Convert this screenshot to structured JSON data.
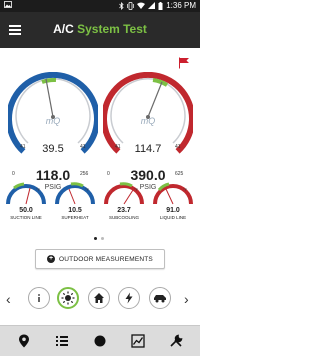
{
  "status_bar": {
    "time": "1:36 PM",
    "left_icon": "image-icon",
    "right_icons": [
      "bluetooth-icon",
      "vibrate-icon",
      "wifi-icon",
      "signal-icon",
      "battery-icon"
    ]
  },
  "app_bar": {
    "title_prefix": "A/C ",
    "title_accent": "System Test",
    "menu_icon": "hamburger-menu-icon"
  },
  "colors": {
    "accent_green": "#7cc044",
    "suction_blue": "#1f5fa8",
    "liquid_red": "#c0282e",
    "appbar": "#2a2a2a",
    "flag_red": "#cc1f2e"
  },
  "gauges": {
    "low_side": {
      "brand": "mQ",
      "temperature": "39.5",
      "pressure": "118.0",
      "unit": "PSIG",
      "scale_min": "0",
      "scale_max": "256",
      "temp_scale_low": "41",
      "temp_scale_high": "41",
      "needle_level": 0.46
    },
    "high_side": {
      "brand": "mQ",
      "temperature": "114.7",
      "pressure": "390.0",
      "unit": "PSIG",
      "scale_min": "0",
      "scale_max": "625",
      "temp_scale_low": "41",
      "temp_scale_high": "41",
      "needle_level": 0.62
    }
  },
  "small_gauges": [
    {
      "value": "50.0",
      "label": "SUCTION LINE",
      "unit": "°F",
      "color": "#1f5fa8"
    },
    {
      "value": "10.5",
      "label": "SUPERHEAT",
      "unit": "°F",
      "color": "#1f5fa8"
    },
    {
      "value": "23.7",
      "label": "SUBCOOLING",
      "unit": "°F",
      "color": "#c0282e"
    },
    {
      "value": "91.0",
      "label": "LIQUID LINE",
      "unit": "°F",
      "color": "#c0282e"
    }
  ],
  "pager": {
    "pages": 2,
    "current": 1
  },
  "outdoor_button": {
    "label": "OUTDOOR MEASUREMENTS",
    "icon": "plus-circle-icon"
  },
  "toolbar_icons": [
    "info-icon",
    "sun-icon",
    "home-icon",
    "bolt-icon",
    "car-icon"
  ],
  "bottom_nav": [
    "location-pin-icon",
    "list-icon",
    "record-circle-icon",
    "chart-icon",
    "tools-icon"
  ]
}
